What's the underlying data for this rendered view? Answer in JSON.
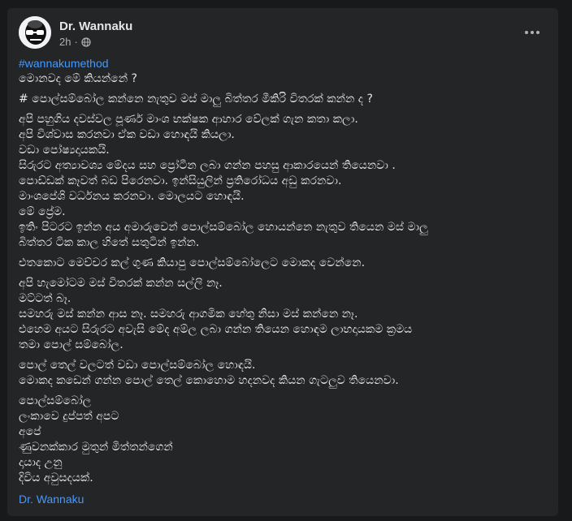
{
  "post": {
    "author": "Dr. Wannaku",
    "time": "2h",
    "visibility_icon": "globe-icon",
    "more_icon": "more-options-icon",
    "hashtag": "#wannakumethod",
    "paragraphs": [
      [
        "මොනවද මේ කියන්නේ ?"
      ],
      [
        "# පොල්සම්බෝල කන්නෙ නැතුව මස් මාලු බිත්තර මීකිරි විතරක් කන්න ද ?"
      ],
      [
        "අපි පහුගිය දවස්වල පූර්ණ මාංශ භක්ෂක ආහාර වේලක් ගැන කතා කලා.",
        "අපි විශ්වාස කරනවා ඒක වඩා හොඳයි කියලා.",
        "වඩා පෝෂ්‍යදායකයි.",
        "සිරුරට අත්‍යාවශ්‍ය මේදය සහ ප්‍රෝටීන ලබා ගන්න පහසු ආකාරයෙන් තියෙනවා .",
        "පොඩ්ඩක් කෑවත් බඩ පිරෙනවා. ඉන්සියුලින් ප්‍රතිරෝධය අඩු කරනවා.",
        "මාංශපේශි වර්ධනය කරනවා. මොලයට හොඳයි.",
        "මේ ප්‍රේම.",
        "ඉතිං පිටරට ඉන්න අය අමාරුවෙන් පොල්සම්බෝල හොයන්නෙ නැතුව තියෙන මස් මාලු",
        "බිත්තර ටික කාල හිතේ සතුටින් ඉන්න."
      ],
      [
        "එතකොට මෙච්චර කල් ගුණ කියාපු පොල්සම්බෝලෙට මොකද වෙන්නෙ."
      ],
      [
        "අපි හැමෝටම මස් විතරක් කන්න සල්ලි නෑ.",
        "මට්ටත් බෑ.",
        "සමහරු මස් කන්න ආස නෑ. සමහරු ආගමික හේතු නිසා මස් කන්නෙ නෑ.",
        "එහෙම අයට සිරුරට අවැසි මේද අම්ල ලබා ගන්න තියෙන හොඳම ලාභදායකම ක්‍රමය",
        "තමා පොල් සම්බෝල."
      ],
      [
        "පොල් තෙල් වලටත් වඩා පොල්සම්බෝල හොඳයි.",
        "මොකද කඩෙන් ගන්න පොල් තෙල් කොහොම හදනවද කියන ගැටලුව තියෙනවා."
      ],
      [
        "පොල්සම්බෝල",
        "ලංකාවෙ දුප්පත් අපට",
        "අපේ",
        "ණුවනක්කාර මුතුන් මිත්තන්ගෙන්",
        "දායාද උනු",
        "දිවිය අවුසදයක්."
      ]
    ],
    "signature": "Dr. Wannaku"
  }
}
